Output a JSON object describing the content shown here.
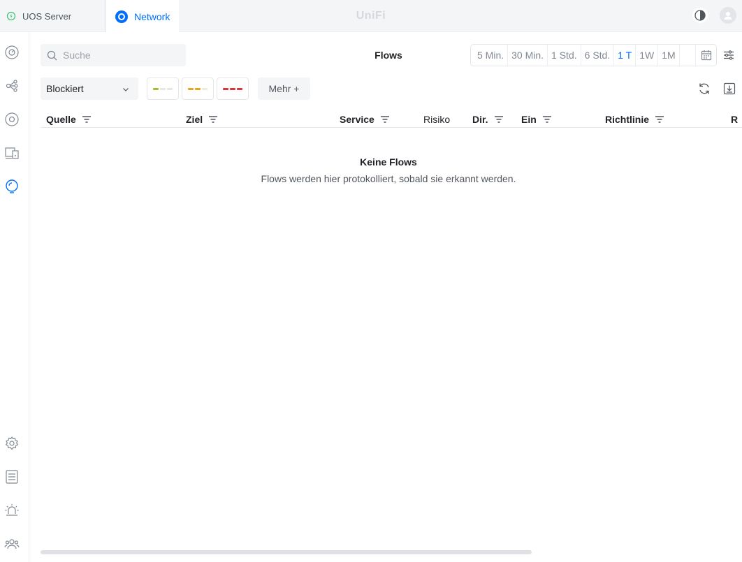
{
  "tabs": {
    "uos_label": "UOS Server",
    "network_label": "Network"
  },
  "brand": "UniFi",
  "search": {
    "placeholder": "Suche"
  },
  "page_title": "Flows",
  "time_ranges": [
    "5 Min.",
    "30 Min.",
    "1 Std.",
    "6 Std.",
    "1 T",
    "1W",
    "1M"
  ],
  "active_time_range": "1 T",
  "filter": {
    "selected": "Blockiert"
  },
  "risk_filters": [
    {
      "name": "low",
      "color": "#9ac331"
    },
    {
      "name": "medium",
      "color": "#e5a722"
    },
    {
      "name": "high",
      "color": "#d9363e"
    }
  ],
  "more_button": "Mehr +",
  "columns": {
    "source": "Quelle",
    "destination": "Ziel",
    "service": "Service",
    "risk": "Risiko",
    "direction": "Dir.",
    "in": "Ein",
    "policy": "Richtlinie",
    "truncated": "R"
  },
  "empty_state": {
    "title": "Keine Flows",
    "description": "Flows werden hier protokolliert, sobald sie erkannt werden."
  },
  "colors": {
    "accent": "#006fff",
    "text": "#212327",
    "muted": "#808893"
  }
}
